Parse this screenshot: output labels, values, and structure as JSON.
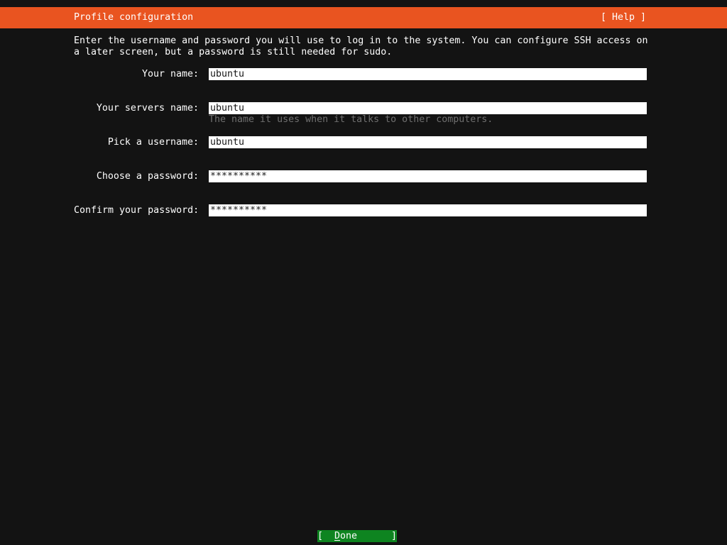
{
  "theme": {
    "background": "#131313",
    "header_bg": "#e95420",
    "header_fg": "#ffffff",
    "text": "#ffffff",
    "muted_text": "#6f6f6f",
    "input_bg": "#ffffff",
    "input_fg": "#151515",
    "button_bg": "#0e8420",
    "button_fg": "#ffffff"
  },
  "header": {
    "title": "Profile configuration",
    "help_label": "[ Help ]"
  },
  "instructions": {
    "lines": [
      "Enter the username and password you will use to log in to the system. You can configure SSH access on",
      "a later screen, but a password is still needed for sudo."
    ]
  },
  "form": {
    "fields": [
      {
        "id": "name",
        "label": "Your name:",
        "value": "ubuntu"
      },
      {
        "id": "hostname",
        "label": "Your servers name:",
        "value": "ubuntu",
        "help": "The name it uses when it talks to other computers."
      },
      {
        "id": "username",
        "label": "Pick a username:",
        "value": "ubuntu"
      },
      {
        "id": "password",
        "label": "Choose a password:",
        "value": "**********"
      },
      {
        "id": "confirm-password",
        "label": "Confirm your password:",
        "value": "**********"
      }
    ]
  },
  "footer": {
    "done_prefix": "[",
    "done_accel": "D",
    "done_rest": "one",
    "done_suffix": "]"
  }
}
